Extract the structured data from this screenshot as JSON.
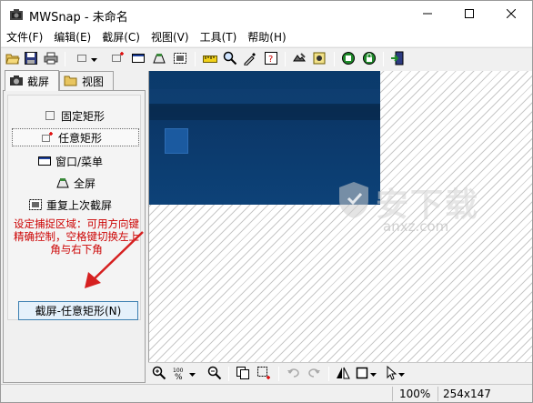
{
  "window": {
    "title": "MWSnap - 未命名",
    "controls": {
      "minimize": "minimize-icon",
      "maximize": "maximize-icon",
      "close": "close-icon"
    }
  },
  "menu": {
    "items": [
      {
        "label": "文件(F)"
      },
      {
        "label": "编辑(E)"
      },
      {
        "label": "截屏(C)"
      },
      {
        "label": "视图(V)"
      },
      {
        "label": "工具(T)"
      },
      {
        "label": "帮助(H)"
      }
    ]
  },
  "toolbar": {
    "icons": [
      "open-icon",
      "save-icon",
      "print-icon",
      "fixed-rect-icon",
      "dropdown-arrow-icon",
      "any-rect-icon",
      "window-menu-icon",
      "full-screen-icon",
      "repeat-capture-icon",
      "ruler-icon",
      "magnifier-icon",
      "color-picker-icon",
      "help-icon",
      "properties-icon",
      "settings-icon",
      "record-icon",
      "lock-icon",
      "exit-icon"
    ]
  },
  "left_panel": {
    "tabs": [
      {
        "label": "截屏",
        "active": true
      },
      {
        "label": "视图",
        "active": false
      }
    ],
    "capture_items": [
      {
        "label": "固定矩形"
      },
      {
        "label": "任意矩形",
        "selected": true
      },
      {
        "label": "窗口/菜单"
      },
      {
        "label": "全屏"
      },
      {
        "label": "重复上次截屏"
      }
    ],
    "hint": "设定捕捉区域：可用方向键精确控制，空格键切换左上角与右下角",
    "capture_button": "截屏-任意矩形(N)"
  },
  "canvas": {
    "watermark_main": "安下载",
    "watermark_sub": "anxz.com"
  },
  "bottom_toolbar": {
    "icons": [
      "zoom-in-icon",
      "zoom-percent-icon",
      "zoom-out-icon",
      "copy-icon",
      "crop-add-icon",
      "undo-icon",
      "redo-icon",
      "flip-icon",
      "border-icon",
      "pointer-icon"
    ]
  },
  "status": {
    "zoom": "100%",
    "size": "254x147"
  },
  "colors": {
    "hint_text": "#cc0000",
    "capture_button_bg": "#e5f1fb",
    "capture_button_border": "#3c7fb1",
    "screenshot_blue": "#0d4278",
    "annotation_arrow": "#d62020"
  }
}
